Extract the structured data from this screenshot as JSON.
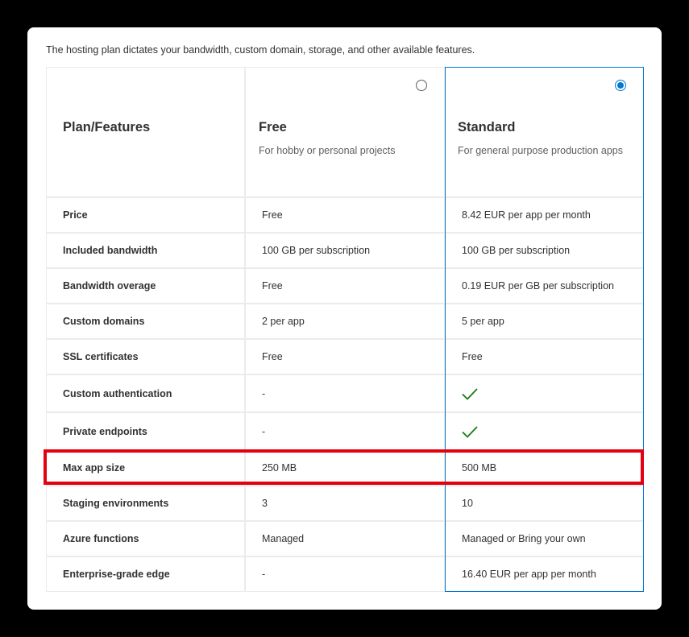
{
  "intro": "The hosting plan dictates your bandwidth, custom domain, storage, and other available features.",
  "header": {
    "features_label": "Plan/Features",
    "plans": [
      {
        "name": "Free",
        "description": "For hobby or personal projects",
        "selected": false
      },
      {
        "name": "Standard",
        "description": "For general purpose production apps",
        "selected": true
      }
    ]
  },
  "rows": [
    {
      "feature": "Price",
      "free": "Free",
      "standard": "8.42 EUR per app per month"
    },
    {
      "feature": "Included bandwidth",
      "free": "100 GB per subscription",
      "standard": "100 GB per subscription"
    },
    {
      "feature": "Bandwidth overage",
      "free": "Free",
      "standard": "0.19 EUR per GB per subscription"
    },
    {
      "feature": "Custom domains",
      "free": "2 per app",
      "standard": "5 per app"
    },
    {
      "feature": "SSL certificates",
      "free": "Free",
      "standard": "Free"
    },
    {
      "feature": "Custom authentication",
      "free": "-",
      "standard_icon": "check-icon"
    },
    {
      "feature": "Private endpoints",
      "free": "-",
      "standard_icon": "check-icon"
    },
    {
      "feature": "Max app size",
      "free": "250 MB",
      "standard": "500 MB",
      "highlighted": true
    },
    {
      "feature": "Staging environments",
      "free": "3",
      "standard": "10"
    },
    {
      "feature": "Azure functions",
      "free": "Managed",
      "standard": "Managed or Bring your own"
    },
    {
      "feature": "Enterprise-grade edge",
      "free": "-",
      "standard": "16.40 EUR per app per month"
    }
  ],
  "colors": {
    "accent": "#0078d4",
    "check": "#107c10",
    "highlight": "#e3000f",
    "grid": "#edebe9"
  }
}
